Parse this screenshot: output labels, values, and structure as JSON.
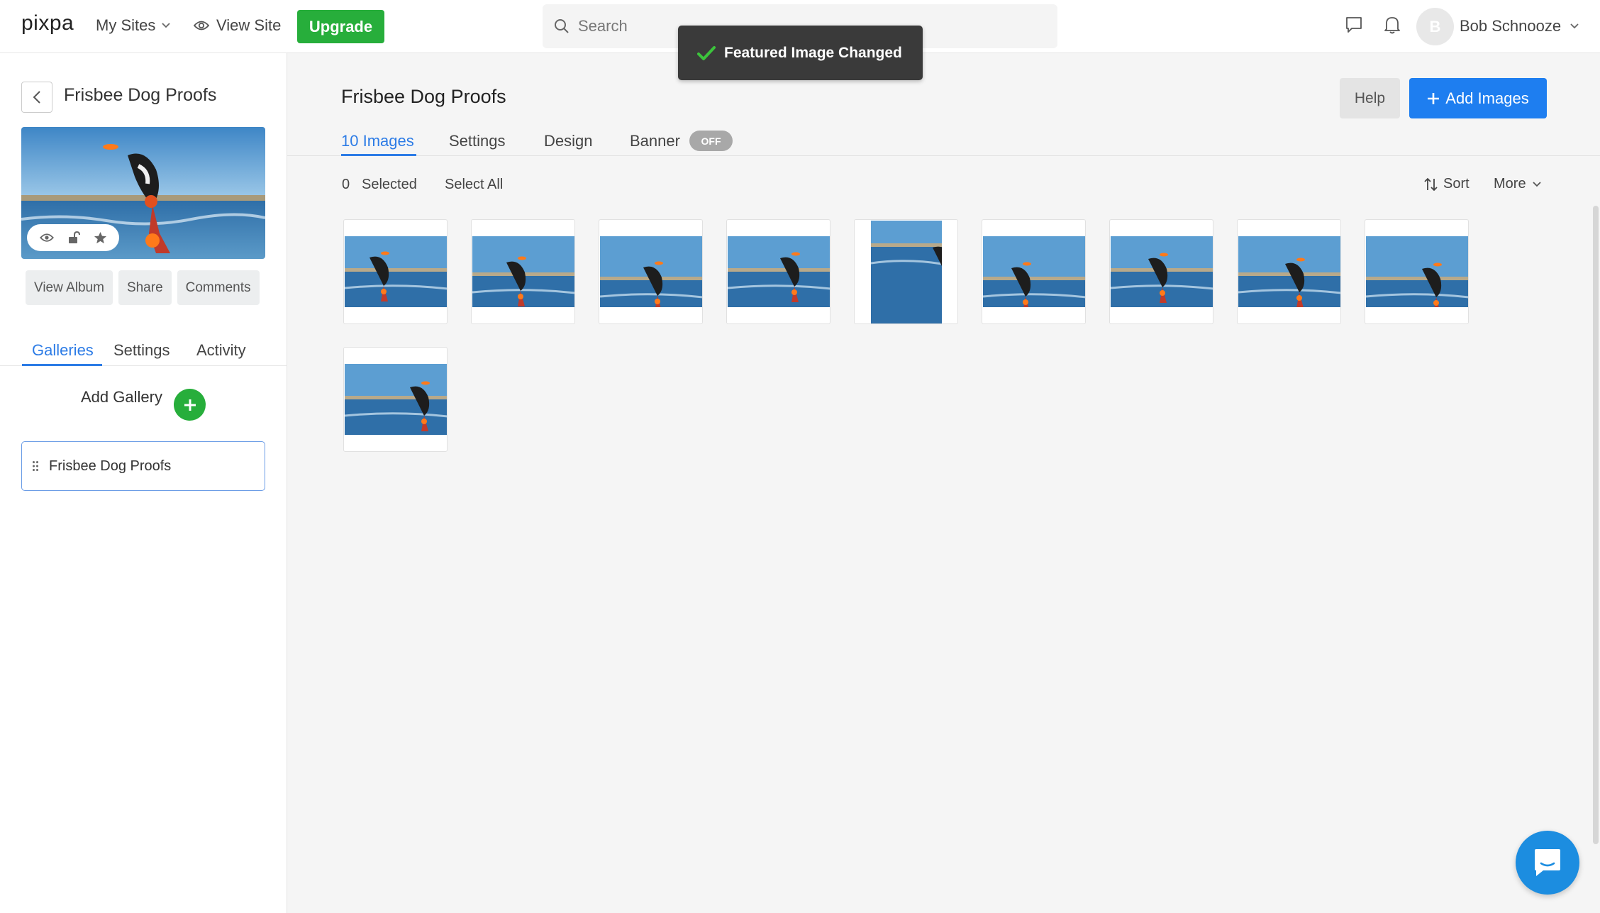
{
  "topbar": {
    "logo": "pixpa",
    "my_sites": "My Sites",
    "view_site": "View Site",
    "upgrade": "Upgrade",
    "search_placeholder": "Search",
    "avatar_initial": "B",
    "user_name": "Bob Schnooze"
  },
  "toast": {
    "message": "Featured Image Changed"
  },
  "sidebar": {
    "album_title": "Frisbee Dog Proofs",
    "buttons": [
      "View Album",
      "Share",
      "Comments"
    ],
    "tabs": [
      "Galleries",
      "Settings",
      "Activity"
    ],
    "active_tab": "Galleries",
    "add_gallery": "Add Gallery",
    "galleries": [
      "Frisbee Dog Proofs"
    ]
  },
  "main": {
    "title": "Frisbee Dog Proofs",
    "help": "Help",
    "add_images": "Add Images",
    "tabs": [
      "10 Images",
      "Settings",
      "Design",
      "Banner"
    ],
    "active_tab": "10 Images",
    "banner_toggle": "OFF",
    "selected_count": "0",
    "selected_label": "Selected",
    "select_all": "Select All",
    "sort": "Sort",
    "more": "More"
  },
  "colors": {
    "accent_blue": "#1e7ef0",
    "upgrade_green": "#27ae3b",
    "tab_active": "#2d7ce6",
    "toast_bg": "#3a3a3a"
  }
}
